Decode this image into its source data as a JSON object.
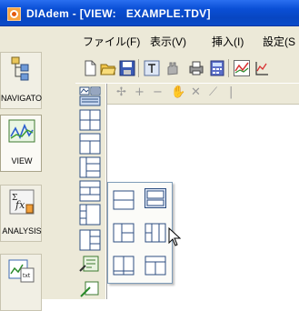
{
  "window": {
    "title": "DIAdem - [VIEW:   EXAMPLE.TDV]",
    "titlebar_color": "#0a4fd6"
  },
  "menu": {
    "items": [
      {
        "label": "ファイル(F)"
      },
      {
        "label": "表示(V)"
      },
      {
        "label": "挿入(I)"
      },
      {
        "label": "設定(S"
      }
    ]
  },
  "navigator": {
    "items": [
      {
        "label": "NAVIGATOR",
        "icon": "navigator-icon"
      },
      {
        "label": "VIEW",
        "icon": "view-chart-icon",
        "active": true
      },
      {
        "label": "ANALYSIS",
        "icon": "formula-fx-icon"
      },
      {
        "label": "",
        "icon": "report-chart-icon"
      }
    ]
  },
  "toolbar": {
    "buttons": [
      "new-document-icon",
      "open-folder-icon",
      "save-icon",
      "text-frame-icon",
      "hand-tool-icon",
      "print-icon",
      "calculator-icon",
      "line-chart-icon",
      "axis-icon"
    ]
  },
  "workspace_toolbar": {
    "tools": [
      "✢",
      "+",
      "−",
      "✋",
      "✕",
      "⟋",
      "|"
    ]
  },
  "layout_menu": {
    "options": [
      "split-horizontal-layout",
      "split-large-top-layout",
      "split-left-two-right-layout",
      "three-column-layout",
      "two-column-wide-layout",
      "top-bar-layout"
    ]
  }
}
